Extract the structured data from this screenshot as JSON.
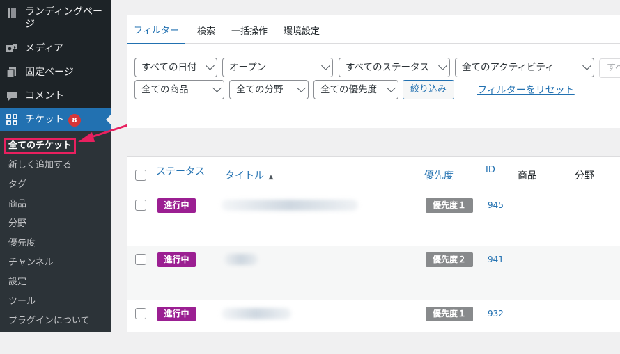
{
  "sidebar": {
    "items": [
      {
        "label": "ランディングページ",
        "icon": "book-icon"
      },
      {
        "label": "メディア",
        "icon": "media-icon"
      },
      {
        "label": "固定ページ",
        "icon": "pages-icon"
      },
      {
        "label": "コメント",
        "icon": "comment-icon"
      },
      {
        "label": "チケット",
        "icon": "grid-icon",
        "badge": "8"
      }
    ],
    "submenu": [
      {
        "label": "全てのチケット"
      },
      {
        "label": "新しく追加する"
      },
      {
        "label": "タグ"
      },
      {
        "label": "商品"
      },
      {
        "label": "分野"
      },
      {
        "label": "優先度"
      },
      {
        "label": "チャンネル"
      },
      {
        "label": "設定"
      },
      {
        "label": "ツール"
      },
      {
        "label": "プラグインについて"
      }
    ]
  },
  "tabs": [
    "フィルター",
    "検索",
    "一括操作",
    "環境設定"
  ],
  "filters": {
    "date": "すべての日付",
    "state": "オープン",
    "status": "すべてのステータス",
    "activity": "全てのアクティビティ",
    "search_placeholder": "すべ",
    "product": "全ての商品",
    "field": "全ての分野",
    "priority": "全ての優先度",
    "apply_label": "絞り込み",
    "reset_label": "フィルターをリセット"
  },
  "table": {
    "headers": {
      "status": "ステータス",
      "title": "タイトル",
      "title_sort_arrow": "▲",
      "priority": "優先度",
      "id": "ID",
      "product": "商品",
      "field": "分野"
    },
    "rows": [
      {
        "status": "進行中",
        "priority": "優先度１",
        "id": "945"
      },
      {
        "status": "進行中",
        "priority": "優先度２",
        "id": "941"
      },
      {
        "status": "進行中",
        "priority": "優先度１",
        "id": "932"
      }
    ]
  },
  "colors": {
    "sidebar_bg": "#1d2327",
    "active_menu": "#2271b1",
    "status_badge": "#9b1f92",
    "priority_badge": "#888a8c",
    "annotation": "#e8205f",
    "link": "#2271b1"
  }
}
